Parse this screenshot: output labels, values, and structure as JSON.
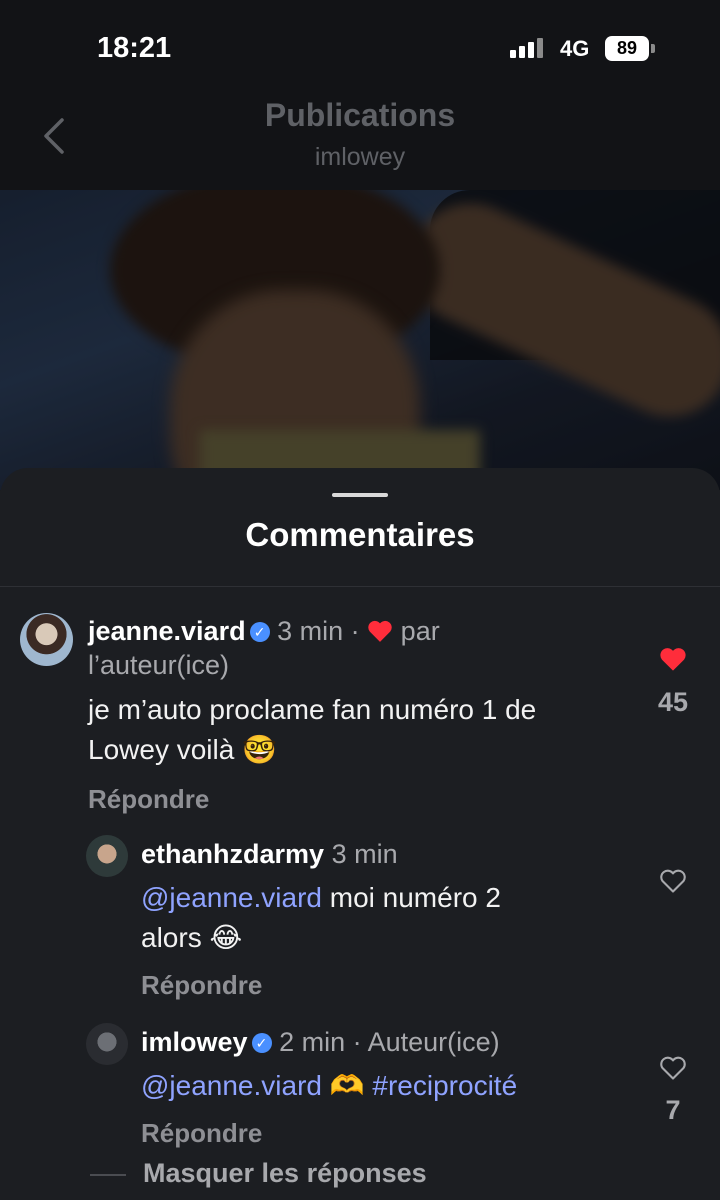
{
  "status": {
    "time": "18:21",
    "network": "4G",
    "battery": "89"
  },
  "header": {
    "title": "Publications",
    "subtitle": "imlowey"
  },
  "sheet": {
    "title": "Commentaires"
  },
  "comments": [
    {
      "username": "jeanne.viard",
      "time": "3 min",
      "separator": "·",
      "liked_by": "par",
      "liked_by_line2": "l’auteur(ice)",
      "text_line1": "je m’auto proclame fan numéro 1 de",
      "text_line2": "Lowey voilà 🤓",
      "reply_label": "Répondre",
      "likes": "45"
    },
    {
      "username": "ethanhzdarmy",
      "time": "3 min",
      "mention": "@jeanne.viard",
      "text_after_mention": " moi numéro 2",
      "text_line2": "alors 😂",
      "reply_label": "Répondre"
    },
    {
      "username": "imlowey",
      "time": "2 min",
      "separator": "·",
      "role": "Auteur(ice)",
      "mention": "@jeanne.viard",
      "emoji": " 🫶 ",
      "hashtag": "#reciprocité",
      "reply_label": "Répondre",
      "likes": "7"
    }
  ],
  "hide_replies": "Masquer les réponses",
  "colors": {
    "accent_blue": "#8fa3ff",
    "like_red": "#ff2d3b",
    "verified": "#4a90ff"
  },
  "icons": [
    "back-chevron-icon",
    "signal-icon",
    "battery-icon",
    "verified-icon",
    "heart-filled-icon",
    "heart-outline-icon"
  ]
}
